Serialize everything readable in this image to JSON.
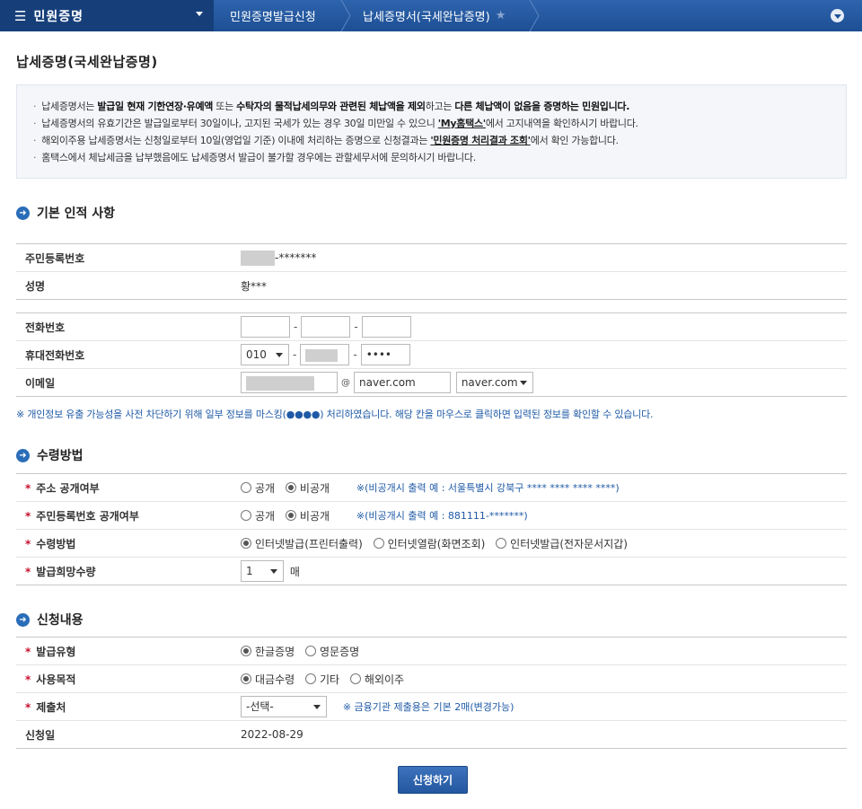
{
  "nav": {
    "menu_title": "민원증명",
    "crumb1": "민원증명발급신청",
    "crumb2": "납세증명서(국세완납증명)"
  },
  "page_title": "납세증명(국세완납증명)",
  "notice": {
    "line1_a": "납세증명서는 ",
    "line1_b": "발급일 현재 기한연장·유예액",
    "line1_c": " 또는 ",
    "line1_d": "수탁자의 물적납세의무와 관련된 체납액을 제외",
    "line1_e": "하고는 ",
    "line1_f": "다른 체납액이 없음을 증명하는 민원입니다.",
    "line2_a": "납세증명서의 유효기간은 발급일로부터 30일이나, 고지된 국세가 있는 경우 30일 미만일 수 있으니 ",
    "line2_link": "'My홈택스'",
    "line2_b": "에서 고지내역을 확인하시기 바랍니다.",
    "line3_a": "해외이주용 납세증명서는 신청일로부터 10일(영업일 기준) 이내에 처리하는 증명으로 신청결과는 ",
    "line3_link": "'민원증명 처리결과 조회'",
    "line3_b": "에서 확인 가능합니다.",
    "line4": "홈택스에서 체납세금을 납부했음에도 납세증명서 발급이 불가할 경우에는 관할세무서에 문의하시기 바랍니다."
  },
  "section1": {
    "title": "기본 인적 사항",
    "rrn_label": "주민등록번호",
    "rrn_suffix": "-*******",
    "name_label": "성명",
    "name_value": "황***",
    "phone_label": "전화번호",
    "mobile_label": "휴대전화번호",
    "mobile_prefix": "010",
    "mobile_last": "••••",
    "email_label": "이메일",
    "email_at": "@",
    "email_domain": "naver.com",
    "email_domain_select": "naver.com"
  },
  "mask_note": "※ 개인정보 유출 가능성을 사전 차단하기 위해 일부 정보를 마스킹(●●●●) 처리하였습니다. 해당 칸을 마우스로 클릭하면 입력된 정보를 확인할 수 있습니다.",
  "section2": {
    "title": "수령방법",
    "addr_label": "주소 공개여부",
    "rrn_open_label": "주민등록번호 공개여부",
    "open": "공개",
    "closed": "비공개",
    "addr_hint": "※(비공개시 출력 예 : 서울특별시 강북구 **** **** **** ****)",
    "rrn_hint": "※(비공개시 출력 예 : 881111-*******)",
    "method_label": "수령방법",
    "method_opt1": "인터넷발급(프린터출력)",
    "method_opt2": "인터넷열람(화면조회)",
    "method_opt3": "인터넷발급(전자문서지갑)",
    "qty_label": "발급희망수량",
    "qty_value": "1",
    "qty_unit": "매"
  },
  "section3": {
    "title": "신청내용",
    "type_label": "발급유형",
    "type_opt1": "한글증명",
    "type_opt2": "영문증명",
    "purpose_label": "사용목적",
    "purpose_opt1": "대금수령",
    "purpose_opt2": "기타",
    "purpose_opt3": "해외이주",
    "dest_label": "제출처",
    "dest_select": "-선택-",
    "dest_hint": "※ 금융기관 제출용은 기본 2매(변경가능)",
    "date_label": "신청일",
    "date_value": "2022-08-29"
  },
  "submit_label": "신청하기"
}
